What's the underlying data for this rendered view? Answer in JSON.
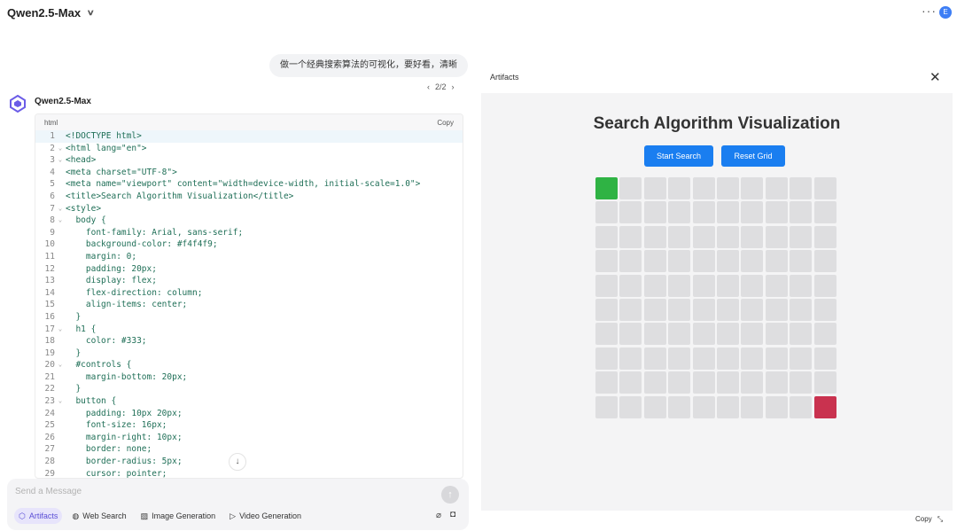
{
  "topbar": {
    "model": "Qwen2.5-Max",
    "avatar_initial": "E"
  },
  "chat": {
    "user_message": "做一个经典搜索算法的可视化，要好看，清晰",
    "pager": "2/2",
    "assistant_name": "Qwen2.5-Max",
    "code": {
      "language": "html",
      "copy_label": "Copy",
      "lines": [
        {
          "n": "1",
          "fold": "",
          "text": "<!DOCTYPE html>"
        },
        {
          "n": "2",
          "fold": "⌄",
          "text": "<html lang=\"en\">"
        },
        {
          "n": "3",
          "fold": "⌄",
          "text": "<head>"
        },
        {
          "n": "4",
          "fold": "",
          "text": "<meta charset=\"UTF-8\">"
        },
        {
          "n": "5",
          "fold": "",
          "text": "<meta name=\"viewport\" content=\"width=device-width, initial-scale=1.0\">"
        },
        {
          "n": "6",
          "fold": "",
          "text": "<title>Search Algorithm Visualization</title>"
        },
        {
          "n": "7",
          "fold": "⌄",
          "text": "<style>"
        },
        {
          "n": "8",
          "fold": "⌄",
          "text": "  body {"
        },
        {
          "n": "9",
          "fold": "",
          "text": "    font-family: Arial, sans-serif;"
        },
        {
          "n": "10",
          "fold": "",
          "text": "    background-color: #f4f4f9;"
        },
        {
          "n": "11",
          "fold": "",
          "text": "    margin: 0;"
        },
        {
          "n": "12",
          "fold": "",
          "text": "    padding: 20px;"
        },
        {
          "n": "13",
          "fold": "",
          "text": "    display: flex;"
        },
        {
          "n": "14",
          "fold": "",
          "text": "    flex-direction: column;"
        },
        {
          "n": "15",
          "fold": "",
          "text": "    align-items: center;"
        },
        {
          "n": "16",
          "fold": "",
          "text": "  }"
        },
        {
          "n": "17",
          "fold": "⌄",
          "text": "  h1 {"
        },
        {
          "n": "18",
          "fold": "",
          "text": "    color: #333;"
        },
        {
          "n": "19",
          "fold": "",
          "text": "  }"
        },
        {
          "n": "20",
          "fold": "⌄",
          "text": "  #controls {"
        },
        {
          "n": "21",
          "fold": "",
          "text": "    margin-bottom: 20px;"
        },
        {
          "n": "22",
          "fold": "",
          "text": "  }"
        },
        {
          "n": "23",
          "fold": "⌄",
          "text": "  button {"
        },
        {
          "n": "24",
          "fold": "",
          "text": "    padding: 10px 20px;"
        },
        {
          "n": "25",
          "fold": "",
          "text": "    font-size: 16px;"
        },
        {
          "n": "26",
          "fold": "",
          "text": "    margin-right: 10px;"
        },
        {
          "n": "27",
          "fold": "",
          "text": "    border: none;"
        },
        {
          "n": "28",
          "fold": "",
          "text": "    border-radius: 5px;"
        },
        {
          "n": "29",
          "fold": "",
          "text": "    cursor: pointer;"
        }
      ]
    }
  },
  "input": {
    "placeholder": "Send a Message",
    "tools": [
      {
        "label": "Artifacts",
        "icon": "cube-icon",
        "selected": true
      },
      {
        "label": "Web Search",
        "icon": "globe-icon",
        "selected": false
      },
      {
        "label": "Image Generation",
        "icon": "image-icon",
        "selected": false
      },
      {
        "label": "Video Generation",
        "icon": "video-icon",
        "selected": false
      }
    ]
  },
  "artifacts": {
    "title": "Artifacts",
    "preview": {
      "heading": "Search Algorithm Visualization",
      "start_button": "Start Search",
      "reset_button": "Reset Grid",
      "grid_rows": 10,
      "grid_cols": 10,
      "start_cell": [
        0,
        0
      ],
      "end_cell": [
        9,
        9
      ],
      "colors": {
        "start": "#2fb344",
        "end": "#c9324f",
        "empty": "#dedee0",
        "button": "#1a7ef0"
      }
    },
    "footer_copy": "Copy"
  }
}
